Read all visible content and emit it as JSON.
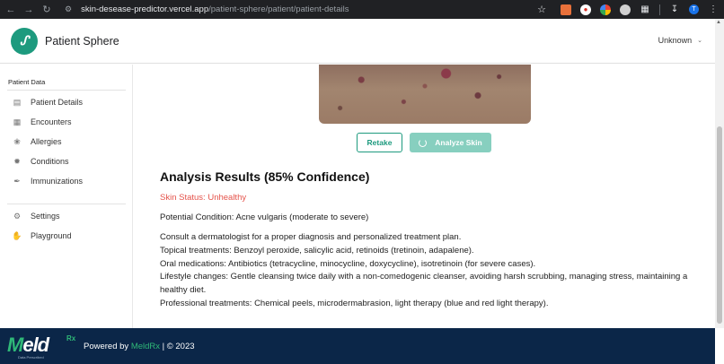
{
  "browser": {
    "url_host": "skin-desease-predictor.vercel.app",
    "url_path": "/patient-sphere/patient/patient-details",
    "profile_initial": "T"
  },
  "header": {
    "app_title": "Patient Sphere",
    "user_label": "Unknown"
  },
  "sidebar": {
    "section_label": "Patient Data",
    "items": [
      {
        "label": "Patient Details",
        "icon": "id-card-icon"
      },
      {
        "label": "Encounters",
        "icon": "calendar-icon"
      },
      {
        "label": "Allergies",
        "icon": "allergy-icon"
      },
      {
        "label": "Conditions",
        "icon": "virus-icon"
      },
      {
        "label": "Immunizations",
        "icon": "syringe-icon"
      }
    ],
    "bottom_items": [
      {
        "label": "Settings",
        "icon": "settings-icon"
      },
      {
        "label": "Playground",
        "icon": "hand-icon"
      }
    ]
  },
  "main": {
    "retake_label": "Retake",
    "analyze_label": "Analyze Skin",
    "results_title": "Analysis Results (85% Confidence)",
    "skin_status": "Skin Status: Unhealthy",
    "potential_condition": "Potential Condition: Acne vulgaris (moderate to severe)",
    "advice_lines": [
      "Consult a dermatologist for a proper diagnosis and personalized treatment plan.",
      "Topical treatments: Benzoyl peroxide, salicylic acid, retinoids (tretinoin, adapalene).",
      "Oral medications: Antibiotics (tetracycline, minocycline, doxycycline), isotretinoin (for severe cases).",
      "Lifestyle changes: Gentle cleansing twice daily with a non-comedogenic cleanser, avoiding harsh scrubbing, managing stress, maintaining a healthy diet.",
      "Professional treatments: Chemical peels, microdermabrasion, light therapy (blue and red light therapy)."
    ]
  },
  "footer": {
    "logo_text_m": "M",
    "logo_text_rest": "eld",
    "logo_rx": "Rx",
    "logo_tagline": "Data Prescribed",
    "powered_by": "Powered by ",
    "powered_link": "MeldRx",
    "copyright": " | © 2023"
  },
  "colors": {
    "brand": "#1d9a7e",
    "status_unhealthy": "#e5534b",
    "footer_bg": "#0b2648"
  }
}
